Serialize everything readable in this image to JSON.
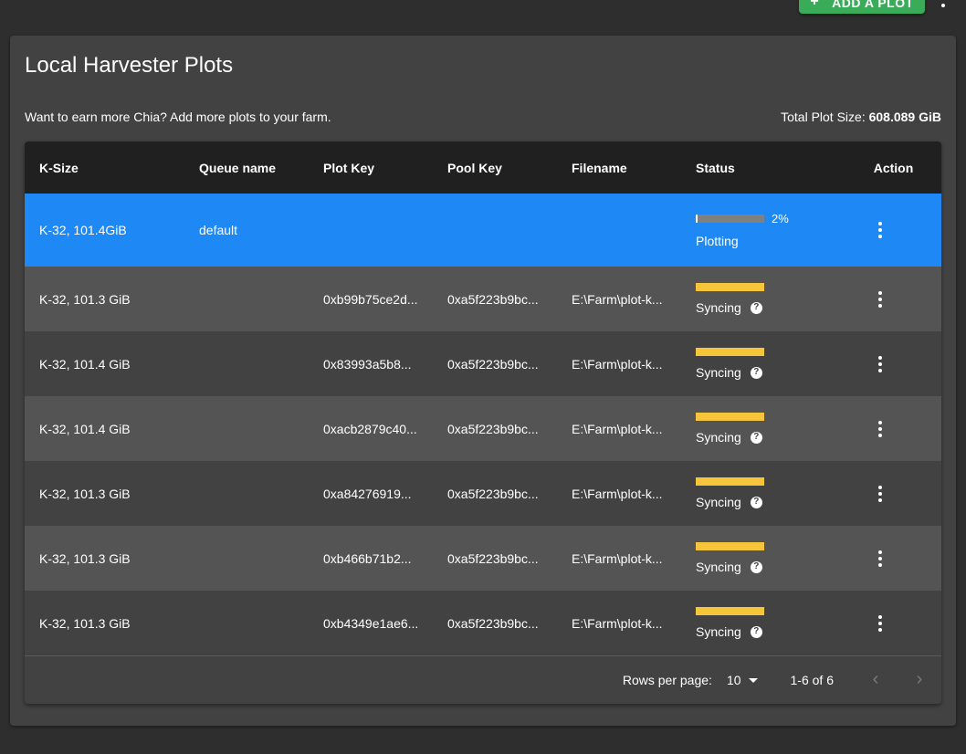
{
  "top_bar": {
    "add_plot_label": "ADD A PLOT"
  },
  "card": {
    "title": "Local Harvester Plots",
    "subtitle": "Want to earn more Chia? Add more plots to your farm.",
    "total_label": "Total Plot Size: ",
    "total_value": "608.089 GiB"
  },
  "table": {
    "columns": [
      "K-Size",
      "Queue name",
      "Plot Key",
      "Pool Key",
      "Filename",
      "Status",
      "Action"
    ],
    "plotting_row": {
      "ksize": "K-32, 101.4GiB",
      "queue": "default",
      "progress": 0.02,
      "progress_label": "2%",
      "status": "Plotting"
    },
    "rows": [
      {
        "ksize": "K-32, 101.3 GiB",
        "plot_key": "0xb99b75ce2d...",
        "pool_key": "0xa5f223b9bc...",
        "filename": "E:\\Farm\\plot-k...",
        "status": "Syncing"
      },
      {
        "ksize": "K-32, 101.4 GiB",
        "plot_key": "0x83993a5b8...",
        "pool_key": "0xa5f223b9bc...",
        "filename": "E:\\Farm\\plot-k...",
        "status": "Syncing"
      },
      {
        "ksize": "K-32, 101.4 GiB",
        "plot_key": "0xacb2879c40...",
        "pool_key": "0xa5f223b9bc...",
        "filename": "E:\\Farm\\plot-k...",
        "status": "Syncing"
      },
      {
        "ksize": "K-32, 101.3 GiB",
        "plot_key": "0xa84276919...",
        "pool_key": "0xa5f223b9bc...",
        "filename": "E:\\Farm\\plot-k...",
        "status": "Syncing"
      },
      {
        "ksize": "K-32, 101.3 GiB",
        "plot_key": "0xb466b71b2...",
        "pool_key": "0xa5f223b9bc...",
        "filename": "E:\\Farm\\plot-k...",
        "status": "Syncing"
      },
      {
        "ksize": "K-32, 101.3 GiB",
        "plot_key": "0xb4349e1ae6...",
        "pool_key": "0xa5f223b9bc...",
        "filename": "E:\\Farm\\plot-k...",
        "status": "Syncing"
      }
    ],
    "help_glyph": "?"
  },
  "pagination": {
    "rows_per_page_label": "Rows per page:",
    "rows_per_page_value": "10",
    "range": "1-6 of 6",
    "prev_glyph": "‹",
    "next_glyph": "›"
  },
  "icons": {
    "add": "plus-icon",
    "more": "more-vert-icon",
    "help": "help-circle-icon",
    "dropdown": "caret-down-icon",
    "prev": "chevron-left-icon",
    "next": "chevron-right-icon"
  },
  "colors": {
    "accent_green": "#3aac59",
    "selected_row": "#1e88f5",
    "sync_bar": "#f7c53a",
    "header_bg": "#202020",
    "card_bg": "#424242",
    "page_bg": "#2e2e2e"
  }
}
